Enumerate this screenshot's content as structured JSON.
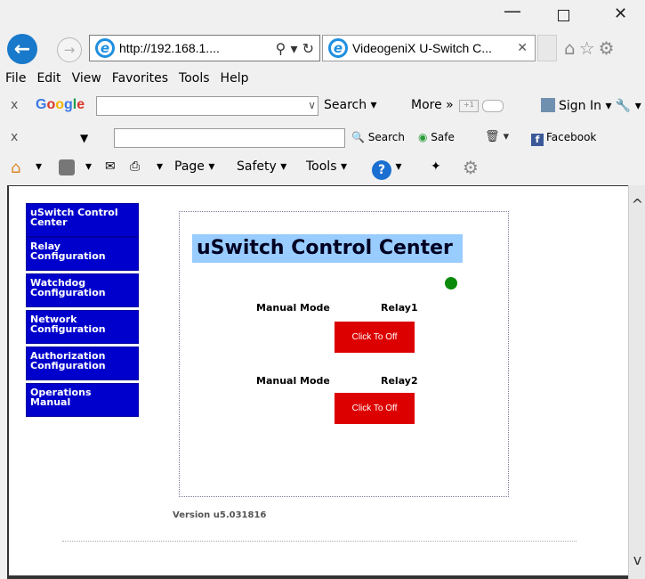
{
  "window": {
    "minimize": "—",
    "close": "✕"
  },
  "address": {
    "back_icon": "arrow-left",
    "forward_icon": "arrow-right",
    "url": "http://192.168.1....",
    "url_icons": "⚲ ▾ ↻",
    "tab_title": "VideogeniX U-Switch C...",
    "tab_close": "✕",
    "right_icons": "⌂☆⚙"
  },
  "menu": [
    "File",
    "Edit",
    "View",
    "Favorites",
    "Tools",
    "Help"
  ],
  "google_toolbar": {
    "close": "x",
    "search_label": "Search ▾",
    "more_label": "More »",
    "plus_label": "+1",
    "signin_label": "Sign In ▾ 🔧 ▾"
  },
  "second_toolbar": {
    "close": "x",
    "search_label": "🔍 Search",
    "safe_label": "Safe",
    "trash": "🗑 ▾",
    "facebook_label": "Facebook"
  },
  "command_bar": {
    "page_label": "Page ▾",
    "safety_label": "Safety ▾",
    "tools_label": "Tools ▾",
    "help_label": "?"
  },
  "sidebar": {
    "items": [
      {
        "label": "uSwitch Control Center"
      },
      {
        "label": "Relay Configuration"
      },
      {
        "label": "Watchdog Configuration"
      },
      {
        "label": "Network Configuration"
      },
      {
        "label": "Authorization Configuration"
      },
      {
        "label": "Operations Manual"
      }
    ]
  },
  "main": {
    "title": "uSwitch Control Center",
    "status_color": "#0a8a0a",
    "relays": [
      {
        "mode_label": "Manual Mode",
        "name": "Relay1",
        "button_label": "Click To Off"
      },
      {
        "mode_label": "Manual Mode",
        "name": "Relay2",
        "button_label": "Click To Off"
      }
    ],
    "version": "Version u5.031816"
  },
  "colors": {
    "nav_blue": "#0000cc",
    "title_bg": "#99ccff",
    "relay_red": "#dd0000"
  }
}
